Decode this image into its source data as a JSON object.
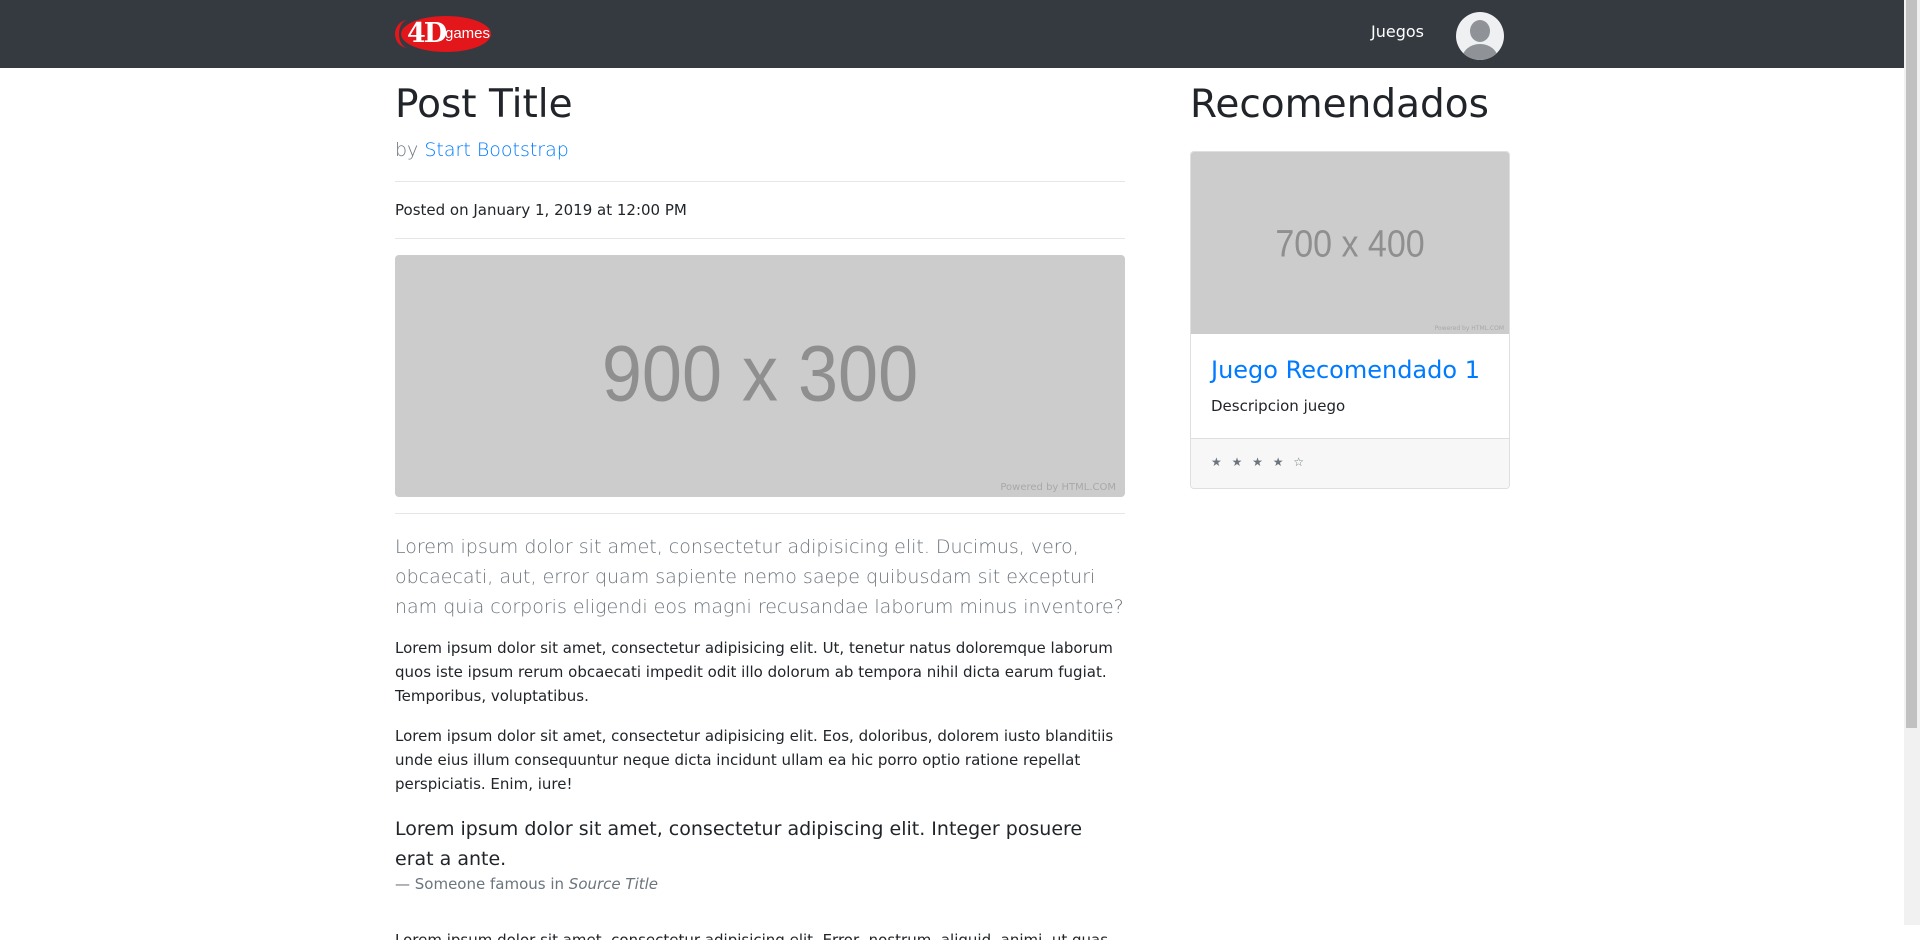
{
  "navbar": {
    "logo": {
      "four_d": "4D",
      "games": "games"
    },
    "juegos_label": "Juegos"
  },
  "post": {
    "title": "Post Title",
    "by_prefix": "by",
    "author": "Start Bootstrap",
    "posted": "Posted on January 1, 2019 at 12:00 PM",
    "hero_image": {
      "size_label": "900 x 300",
      "powered": "Powered by HTML.COM"
    },
    "lead": "Lorem ipsum dolor sit amet, consectetur adipisicing elit. Ducimus, vero, obcaecati, aut, error quam sapiente nemo saepe quibusdam sit excepturi nam quia corporis eligendi eos magni recusandae laborum minus inventore?",
    "paragraph_1": "Lorem ipsum dolor sit amet, consectetur adipisicing elit. Ut, tenetur natus doloremque laborum quos iste ipsum rerum obcaecati impedit odit illo dolorum ab tempora nihil dicta earum fugiat. Temporibus, voluptatibus.",
    "paragraph_2": "Lorem ipsum dolor sit amet, consectetur adipisicing elit. Eos, doloribus, dolorem iusto blanditiis unde eius illum consequuntur neque dicta incidunt ullam ea hic porro optio ratione repellat perspiciatis. Enim, iure!",
    "quote": "Lorem ipsum dolor sit amet, consectetur adipiscing elit. Integer posuere erat a ante.",
    "quote_footer_prefix": "— Someone famous in",
    "quote_source": "Source Title",
    "paragraph_3": "Lorem ipsum dolor sit amet, consectetur adipisicing elit. Error, nostrum, aliquid, animi, ut quas placeat"
  },
  "sidebar": {
    "title": "Recomendados",
    "card": {
      "image": {
        "size_label": "700 x 400",
        "powered": "Powered by HTML.COM"
      },
      "title": "Juego Recomendado 1",
      "description": "Descripcion juego",
      "rating": "★ ★ ★ ★ ☆"
    }
  }
}
